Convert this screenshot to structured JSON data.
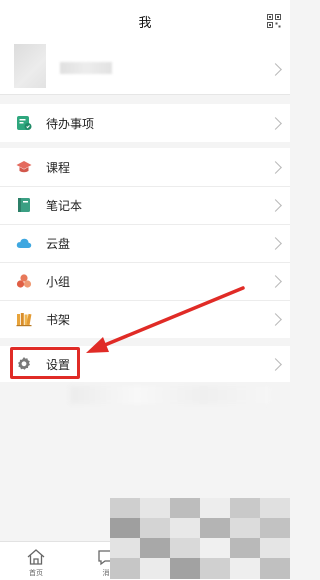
{
  "header": {
    "title": "我",
    "qr_icon": "qr-code-icon"
  },
  "profile": {
    "avatar_icon": "avatar-placeholder",
    "username": ""
  },
  "menu": {
    "todo": {
      "label": "待办事项",
      "icon": "todo-list-icon",
      "color": "#2fa77e"
    },
    "items": [
      {
        "label": "课程",
        "icon": "graduation-cap-icon",
        "color": "#e46b5f"
      },
      {
        "label": "笔记本",
        "icon": "notebook-icon",
        "color": "#3b9f83"
      },
      {
        "label": "云盘",
        "icon": "cloud-icon",
        "color": "#3ea7e0"
      },
      {
        "label": "小组",
        "icon": "group-icon",
        "color": "#e8795a"
      },
      {
        "label": "书架",
        "icon": "bookshelf-icon",
        "color": "#e8a43b"
      }
    ],
    "settings": {
      "label": "设置",
      "icon": "gear-icon",
      "color": "#7a7a7a"
    }
  },
  "annotation": {
    "highlight_color": "#e02b26"
  },
  "tabbar": {
    "tabs": [
      {
        "label": "首页",
        "icon": "home-icon"
      },
      {
        "label": "消",
        "icon": "message-icon"
      }
    ]
  }
}
